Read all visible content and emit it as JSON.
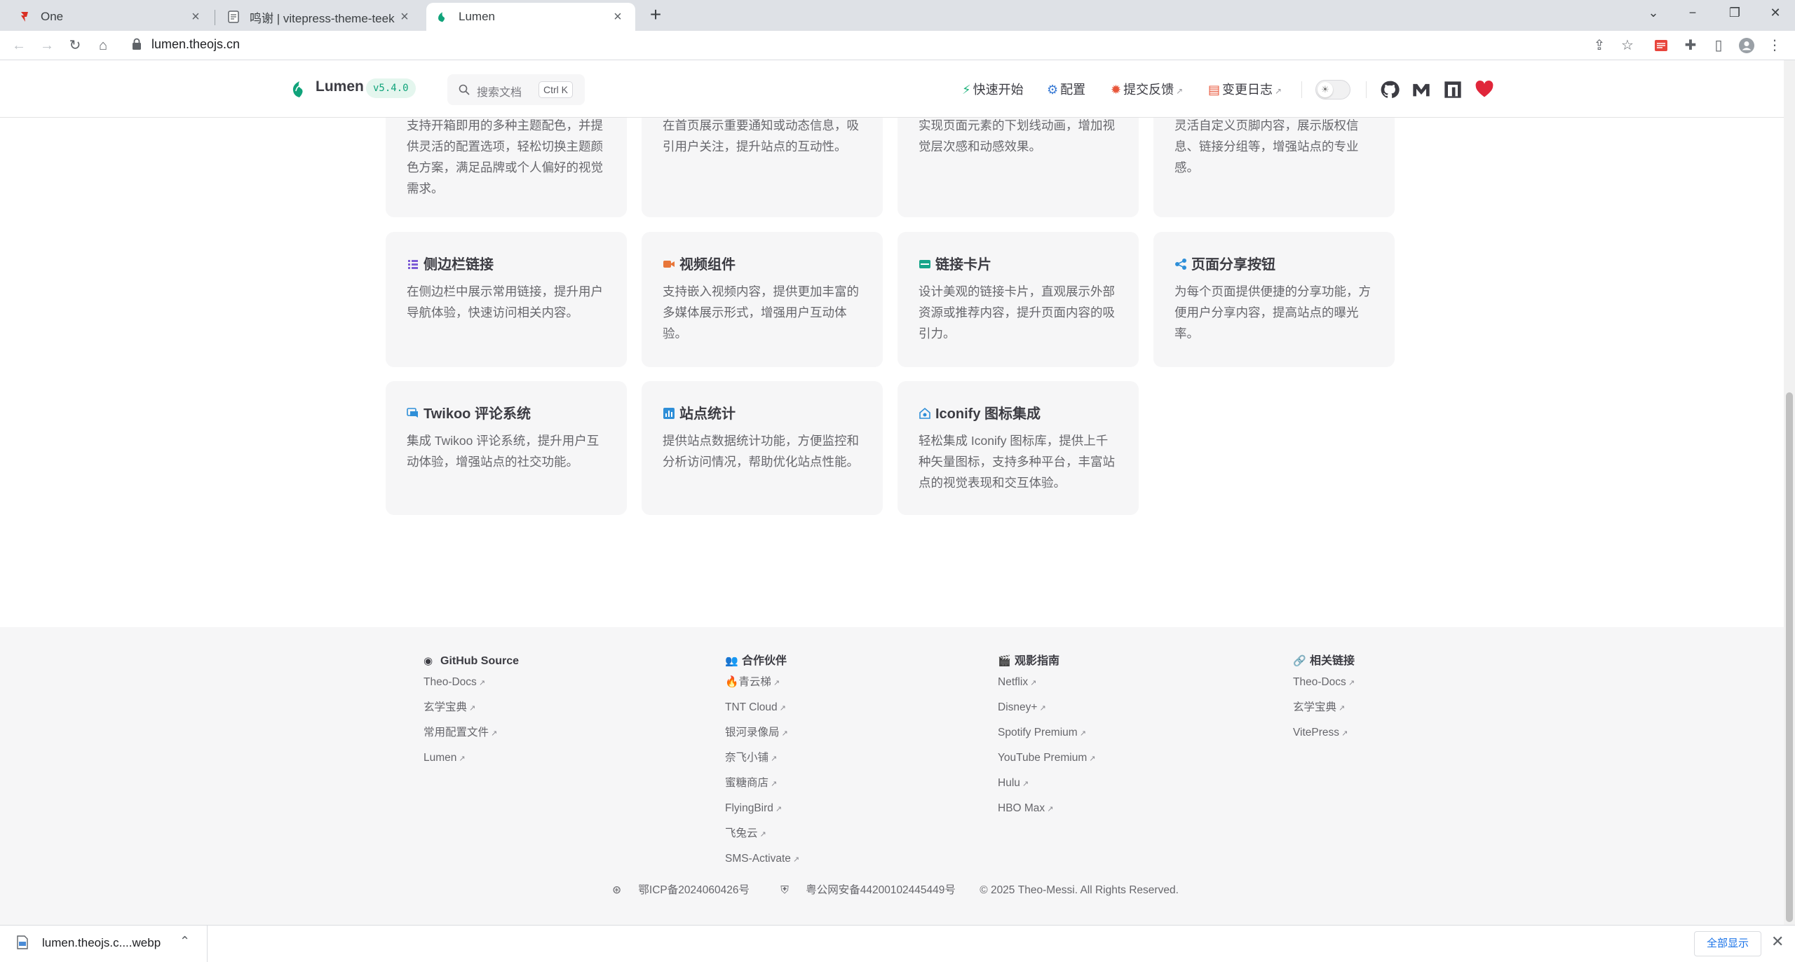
{
  "browser": {
    "tabs": [
      {
        "title": "One",
        "active": false
      },
      {
        "title": "鸣谢 | vitepress-theme-teek",
        "active": false
      },
      {
        "title": "Lumen",
        "active": true
      }
    ],
    "url": "lumen.theojs.cn"
  },
  "nav": {
    "brand": "Lumen",
    "version": "v5.4.0",
    "search_placeholder": "搜索文档",
    "search_shortcut": "Ctrl K",
    "links": [
      {
        "label": "快速开始",
        "icon": "bolt-icon",
        "external": false
      },
      {
        "label": "配置",
        "icon": "gears-icon",
        "external": false
      },
      {
        "label": "提交反馈",
        "icon": "bug-icon",
        "external": true
      },
      {
        "label": "变更日志",
        "icon": "clipboard-icon",
        "external": true
      }
    ],
    "social": [
      "github-icon",
      "mastodon-icon",
      "npm-icon",
      "heart-icon"
    ]
  },
  "features_top_row": [
    {
      "desc": "支持开箱即用的多种主题配色，并提供灵活的配置选项，轻松切换主题颜色方案，满足品牌或个人偏好的视觉需求。"
    },
    {
      "desc": "在首页展示重要通知或动态信息，吸引用户关注，提升站点的互动性。"
    },
    {
      "desc": "实现页面元素的下划线动画，增加视觉层次感和动感效果。"
    },
    {
      "desc": "灵活自定义页脚内容，展示版权信息、链接分组等，增强站点的专业感。"
    }
  ],
  "features": [
    {
      "title": "侧边栏链接",
      "icon": "list-icon",
      "icon_color": "#7c5cd6",
      "desc": "在侧边栏中展示常用链接，提升用户导航体验，快速访问相关内容。"
    },
    {
      "title": "视频组件",
      "icon": "video-icon",
      "icon_color": "#e8763a",
      "desc": "支持嵌入视频内容，提供更加丰富的多媒体展示形式，增强用户互动体验。"
    },
    {
      "title": "链接卡片",
      "icon": "card-icon",
      "icon_color": "#16a58a",
      "desc": "设计美观的链接卡片，直观展示外部资源或推荐内容，提升页面内容的吸引力。"
    },
    {
      "title": "页面分享按钮",
      "icon": "share-icon",
      "icon_color": "#2f8fd8",
      "desc": "为每个页面提供便捷的分享功能，方便用户分享内容，提高站点的曝光率。"
    },
    {
      "title": "Twikoo 评论系统",
      "icon": "comment-icon",
      "icon_color": "#2f8fd8",
      "desc": "集成 Twikoo 评论系统，提升用户互动体验，增强站点的社交功能。"
    },
    {
      "title": "站点统计",
      "icon": "chart-icon",
      "icon_color": "#2f8fd8",
      "desc": "提供站点数据统计功能，方便监控和分析访问情况，帮助优化站点性能。"
    },
    {
      "title": "Iconify 图标集成",
      "icon": "iconify-icon",
      "icon_color": "#2f8fd8",
      "desc": "轻松集成 Iconify 图标库，提供上千种矢量图标，支持多种平台，丰富站点的视觉表现和交互体验。"
    }
  ],
  "footer": {
    "columns": [
      {
        "title": "GitHub Source",
        "icon": "github-icon",
        "links": [
          "Theo-Docs",
          "玄学宝典",
          "常用配置文件",
          "Lumen"
        ]
      },
      {
        "title": "合作伙伴",
        "icon": "users-icon",
        "links": [
          "青云梯",
          "TNT Cloud",
          "银河录像局",
          "奈飞小铺",
          "蜜糖商店",
          "FlyingBird",
          "飞兔云",
          "SMS-Activate"
        ]
      },
      {
        "title": "观影指南",
        "icon": "clapper-icon",
        "links": [
          "Netflix",
          "Disney+",
          "Spotify Premium",
          "YouTube Premium",
          "Hulu",
          "HBO Max"
        ]
      },
      {
        "title": "相关链接",
        "icon": "link-icon",
        "links": [
          "Theo-Docs",
          "玄学宝典",
          "VitePress"
        ]
      }
    ],
    "icp": "鄂ICP备2024060426号",
    "police": "粤公网安备44200102445449号",
    "copyright": "© 2025 Theo-Messi. All Rights Reserved."
  },
  "downloads": {
    "file": "lumen.theojs.c....webp",
    "show_all": "全部显示"
  },
  "colors": {
    "brand": "#10a37a",
    "card_bg": "#f6f6f7",
    "footer_bg": "#f6f6f7"
  }
}
